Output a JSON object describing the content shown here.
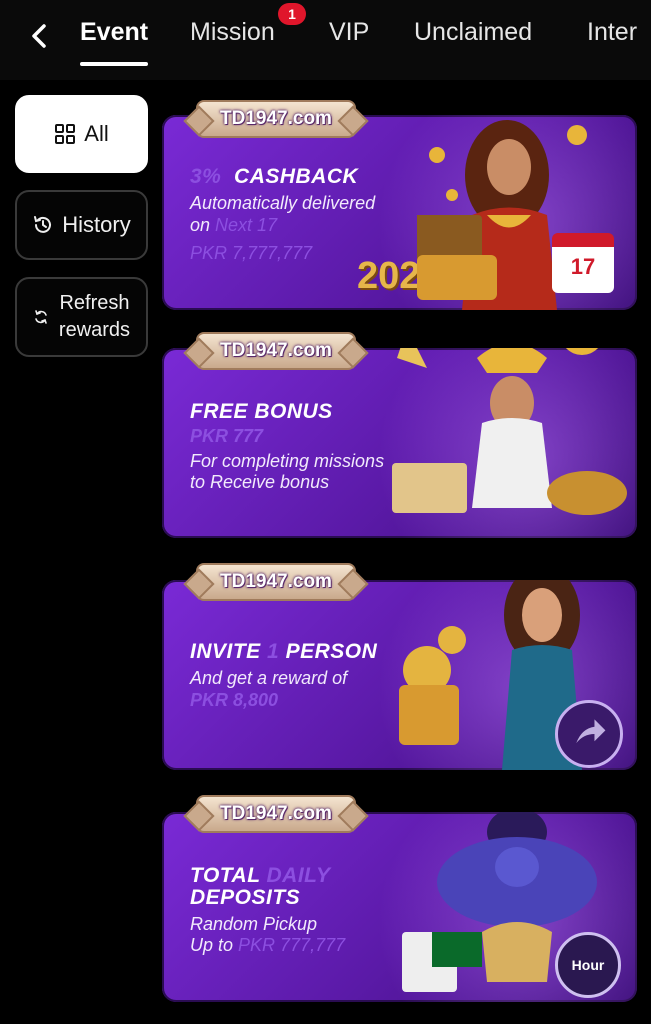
{
  "tabs": [
    {
      "label": "Event",
      "active": true
    },
    {
      "label": "Mission",
      "badge": "1"
    },
    {
      "label": "VIP"
    },
    {
      "label": "Unclaimed"
    },
    {
      "label": "Inter"
    }
  ],
  "sidebar": {
    "items": [
      {
        "label": "All",
        "icon": "grid-icon",
        "active": true
      },
      {
        "label": "History",
        "icon": "history-icon"
      },
      {
        "label": "Refresh rewards",
        "line1": "Refresh",
        "line2": "rewards",
        "icon": "refresh-icon"
      }
    ]
  },
  "brand": "TD1947.com",
  "cards": [
    {
      "title_ghost": "3%",
      "title": "CASHBACK",
      "line1": "Automatically delivered",
      "line2_prefix": "on",
      "line2_ghost": "Next 17",
      "line3_ghost": "PKR 7,777,777",
      "year": "2025",
      "calendar_day": "17"
    },
    {
      "title": "FREE  BONUS",
      "amount_ghost": "PKR  777",
      "line1": "For completing missions",
      "line2": "to Receive bonus"
    },
    {
      "title_a": "INVITE",
      "title_ghost": "1",
      "title_b": "PERSON",
      "line1": "And get a reward of",
      "line2_ghost": "PKR 8,800"
    },
    {
      "title_a": "TOTAL",
      "title_ghost": "DAILY",
      "title_b": "DEPOSITS",
      "line1": "Random Pickup",
      "line2_prefix": "Up to",
      "line2_ghost": "PKR 777,777",
      "timer_label": "Hour"
    }
  ],
  "colors": {
    "card_purple": "#6a22c0",
    "badge_red": "#e0162b",
    "gold": "#e8b53a"
  }
}
